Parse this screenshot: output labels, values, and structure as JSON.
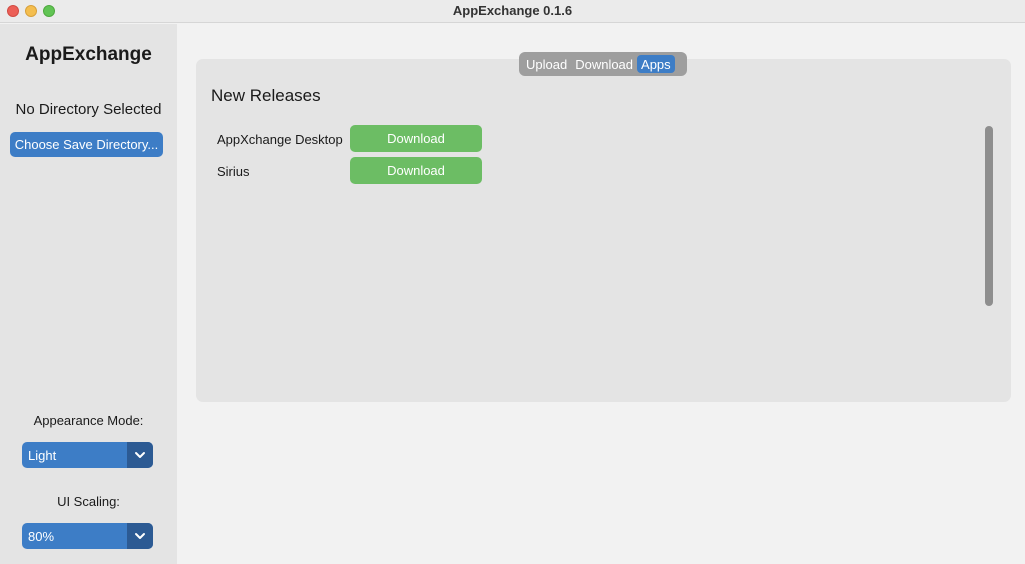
{
  "window": {
    "title": "AppExchange 0.1.6"
  },
  "sidebar": {
    "app_title": "AppExchange",
    "directory_status": "No Directory Selected",
    "choose_button": "Choose Save Directory...",
    "appearance": {
      "label": "Appearance Mode:",
      "value": "Light"
    },
    "scaling": {
      "label": "UI Scaling:",
      "value": "80%"
    }
  },
  "tabs": [
    {
      "label": "Upload",
      "active": false
    },
    {
      "label": "Download",
      "active": false
    },
    {
      "label": "Apps",
      "active": true
    }
  ],
  "main": {
    "section_title": "New Releases",
    "releases": [
      {
        "name": "AppXchange Desktop",
        "button": "Download"
      },
      {
        "name": "Sirius",
        "button": "Download"
      }
    ]
  },
  "colors": {
    "accent": "#3d7dc6",
    "download_button": "#6cbd64",
    "sidebar_bg": "#e4e4e4"
  }
}
